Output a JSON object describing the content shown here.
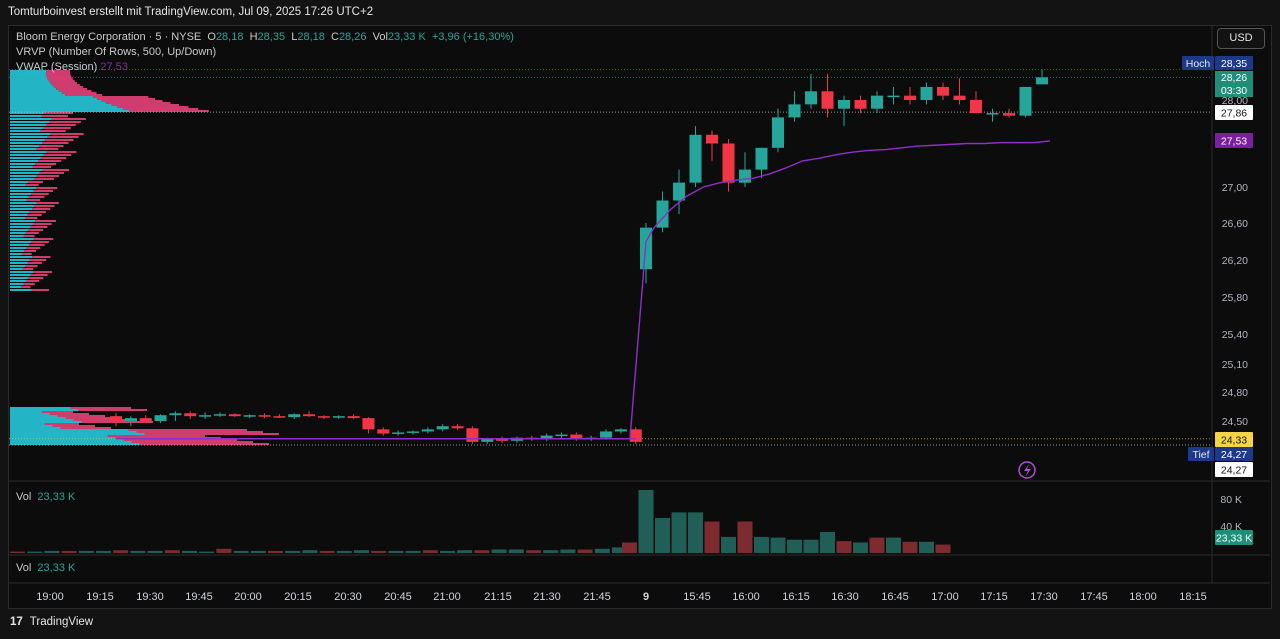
{
  "header": {
    "title": "Tomturboinvest erstellt mit TradingView.com, Jul 09, 2025 17:26 UTC+2"
  },
  "legend": {
    "symbol": "Bloom Energy Corporation · 5 · NYSE",
    "o_label": "O",
    "o": "28,18",
    "h_label": "H",
    "h": "28,35",
    "l_label": "L",
    "l": "28,18",
    "c_label": "C",
    "c": "28,26",
    "vol_label": "Vol",
    "vol": "23,33 K",
    "change": "+3,96 (+16,30%)",
    "vrvp": "VRVP (Number Of Rows, 500, Up/Down)",
    "vwap_label": "VWAP (Session)",
    "vwap": "27,53"
  },
  "currency_button": "USD",
  "vol_pane": {
    "label": "Vol",
    "value": "23,33 K"
  },
  "vol_pane2": {
    "label": "Vol",
    "value": "23,33 K"
  },
  "footer": {
    "brand": "TradingView",
    "logo_glyph": "17"
  },
  "colors": {
    "up": "#26a69a",
    "down": "#f23645",
    "vwap": "#8e2fc9",
    "vol_up": "#1f5f57",
    "vol_down": "#7d2b2f",
    "profile_up": "#26c6da",
    "profile_down": "#f2457f"
  },
  "chart_data": {
    "type": "candlestick",
    "price_axis_ticks": [
      "28,00",
      "27,00",
      "26,60",
      "26,20",
      "25,80",
      "25,40",
      "25,10",
      "24,80",
      "24,50"
    ],
    "price_ylim": [
      23.97,
      28.5
    ],
    "price_tags": [
      {
        "label": "Hoch",
        "value": "28,35"
      },
      {
        "value": "28,26",
        "sub": "03:30"
      },
      {
        "value": "27,86"
      },
      {
        "value": "27,53"
      },
      {
        "value": "24,33"
      },
      {
        "label": "Tief",
        "value": "24,27"
      },
      {
        "value": "24,27"
      }
    ],
    "volume_axis_ticks": [
      "80 K",
      "40 K"
    ],
    "volume_tag": "23,33 K",
    "x_ticks": [
      "19:00",
      "19:15",
      "19:30",
      "19:45",
      "20:00",
      "20:15",
      "20:30",
      "20:45",
      "21:00",
      "21:15",
      "21:30",
      "21:45",
      "9",
      "15:45",
      "16:00",
      "16:15",
      "16:30",
      "16:45",
      "17:00",
      "17:15",
      "17:30",
      "17:45",
      "18:00",
      "18:15"
    ],
    "candles_pre": [
      {
        "o": 24.55,
        "h": 24.58,
        "l": 24.45,
        "c": 24.5
      },
      {
        "o": 24.5,
        "h": 24.55,
        "l": 24.45,
        "c": 24.53
      },
      {
        "o": 24.53,
        "h": 24.56,
        "l": 24.48,
        "c": 24.5
      },
      {
        "o": 24.5,
        "h": 24.57,
        "l": 24.48,
        "c": 24.56
      },
      {
        "o": 24.56,
        "h": 24.6,
        "l": 24.5,
        "c": 24.58
      },
      {
        "o": 24.58,
        "h": 24.6,
        "l": 24.52,
        "c": 24.55
      },
      {
        "o": 24.55,
        "h": 24.59,
        "l": 24.52,
        "c": 24.56
      },
      {
        "o": 24.56,
        "h": 24.59,
        "l": 24.54,
        "c": 24.57
      },
      {
        "o": 24.57,
        "h": 24.58,
        "l": 24.54,
        "c": 24.55
      },
      {
        "o": 24.55,
        "h": 24.57,
        "l": 24.53,
        "c": 24.56
      },
      {
        "o": 24.56,
        "h": 24.58,
        "l": 24.53,
        "c": 24.55
      },
      {
        "o": 24.55,
        "h": 24.57,
        "l": 24.53,
        "c": 24.54
      },
      {
        "o": 24.54,
        "h": 24.58,
        "l": 24.52,
        "c": 24.57
      },
      {
        "o": 24.57,
        "h": 24.6,
        "l": 24.54,
        "c": 24.55
      },
      {
        "o": 24.55,
        "h": 24.56,
        "l": 24.52,
        "c": 24.54
      },
      {
        "o": 24.54,
        "h": 24.56,
        "l": 24.52,
        "c": 24.55
      },
      {
        "o": 24.55,
        "h": 24.57,
        "l": 24.52,
        "c": 24.53
      },
      {
        "o": 24.53,
        "h": 24.54,
        "l": 24.38,
        "c": 24.42
      },
      {
        "o": 24.42,
        "h": 24.44,
        "l": 24.36,
        "c": 24.38
      },
      {
        "o": 24.38,
        "h": 24.41,
        "l": 24.36,
        "c": 24.39
      },
      {
        "o": 24.39,
        "h": 24.41,
        "l": 24.37,
        "c": 24.4
      },
      {
        "o": 24.4,
        "h": 24.44,
        "l": 24.38,
        "c": 24.42
      },
      {
        "o": 24.42,
        "h": 24.47,
        "l": 24.4,
        "c": 24.45
      },
      {
        "o": 24.45,
        "h": 24.47,
        "l": 24.41,
        "c": 24.43
      },
      {
        "o": 24.43,
        "h": 24.45,
        "l": 24.28,
        "c": 24.3
      },
      {
        "o": 24.3,
        "h": 24.34,
        "l": 24.28,
        "c": 24.33
      },
      {
        "o": 24.33,
        "h": 24.35,
        "l": 24.29,
        "c": 24.31
      },
      {
        "o": 24.31,
        "h": 24.35,
        "l": 24.29,
        "c": 24.34
      },
      {
        "o": 24.34,
        "h": 24.36,
        "l": 24.31,
        "c": 24.33
      },
      {
        "o": 24.33,
        "h": 24.38,
        "l": 24.31,
        "c": 24.36
      },
      {
        "o": 24.36,
        "h": 24.39,
        "l": 24.33,
        "c": 24.37
      },
      {
        "o": 24.37,
        "h": 24.39,
        "l": 24.31,
        "c": 24.33
      },
      {
        "o": 24.33,
        "h": 24.36,
        "l": 24.31,
        "c": 24.34
      },
      {
        "o": 24.34,
        "h": 24.42,
        "l": 24.32,
        "c": 24.4
      },
      {
        "o": 24.4,
        "h": 24.43,
        "l": 24.38,
        "c": 24.42
      },
      {
        "o": 24.42,
        "h": 24.44,
        "l": 24.28,
        "c": 24.3
      }
    ],
    "candles_session": [
      {
        "o": 26.1,
        "h": 26.6,
        "l": 25.95,
        "c": 26.55
      },
      {
        "o": 26.55,
        "h": 26.95,
        "l": 26.5,
        "c": 26.85
      },
      {
        "o": 26.85,
        "h": 27.2,
        "l": 26.7,
        "c": 27.05
      },
      {
        "o": 27.05,
        "h": 27.7,
        "l": 27.0,
        "c": 27.6
      },
      {
        "o": 27.6,
        "h": 27.65,
        "l": 27.3,
        "c": 27.5
      },
      {
        "o": 27.5,
        "h": 27.55,
        "l": 26.95,
        "c": 27.05
      },
      {
        "o": 27.05,
        "h": 27.4,
        "l": 27.0,
        "c": 27.2
      },
      {
        "o": 27.2,
        "h": 27.45,
        "l": 27.1,
        "c": 27.45
      },
      {
        "o": 27.45,
        "h": 27.9,
        "l": 27.4,
        "c": 27.8
      },
      {
        "o": 27.8,
        "h": 28.1,
        "l": 27.75,
        "c": 27.95
      },
      {
        "o": 27.95,
        "h": 28.3,
        "l": 27.9,
        "c": 28.1
      },
      {
        "o": 28.1,
        "h": 28.3,
        "l": 27.8,
        "c": 27.9
      },
      {
        "o": 27.9,
        "h": 28.05,
        "l": 27.7,
        "c": 28.0
      },
      {
        "o": 28.0,
        "h": 28.05,
        "l": 27.85,
        "c": 27.9
      },
      {
        "o": 27.9,
        "h": 28.1,
        "l": 27.85,
        "c": 28.05
      },
      {
        "o": 28.05,
        "h": 28.15,
        "l": 27.95,
        "c": 28.05
      },
      {
        "o": 28.05,
        "h": 28.15,
        "l": 27.95,
        "c": 28.0
      },
      {
        "o": 28.0,
        "h": 28.2,
        "l": 27.95,
        "c": 28.15
      },
      {
        "o": 28.15,
        "h": 28.2,
        "l": 28.0,
        "c": 28.05
      },
      {
        "o": 28.05,
        "h": 28.25,
        "l": 27.95,
        "c": 28.0
      },
      {
        "o": 28.0,
        "h": 28.1,
        "l": 27.85,
        "c": 27.85
      },
      {
        "o": 27.85,
        "h": 27.9,
        "l": 27.75,
        "c": 27.85
      },
      {
        "o": 27.85,
        "h": 27.9,
        "l": 27.8,
        "c": 27.82
      },
      {
        "o": 27.82,
        "h": 28.15,
        "l": 27.8,
        "c": 28.15
      },
      {
        "o": 28.18,
        "h": 28.35,
        "l": 28.18,
        "c": 28.26
      }
    ],
    "vwap_session": [
      26.55,
      26.75,
      26.9,
      27.0,
      27.05,
      27.08,
      27.1,
      27.15,
      27.22,
      27.3,
      27.33,
      27.37,
      27.4,
      27.42,
      27.43,
      27.45,
      27.47,
      27.48,
      27.49,
      27.5,
      27.5,
      27.51,
      27.51,
      27.51,
      27.53
    ],
    "volume_pre": [
      2,
      2,
      3,
      3,
      3,
      3,
      4,
      3,
      3,
      4,
      3,
      2,
      6,
      3,
      3,
      3,
      3,
      4,
      3,
      3,
      4,
      3,
      3,
      3,
      4,
      3,
      4,
      4,
      5,
      5,
      4,
      4,
      5,
      5,
      6,
      8
    ],
    "volume_session": [
      15,
      90,
      50,
      58,
      58,
      45,
      23,
      45,
      23,
      22,
      19,
      19,
      30,
      17,
      15,
      22,
      22,
      16,
      16,
      12
    ],
    "volume_session_up": [
      false,
      true,
      true,
      true,
      true,
      false,
      true,
      false,
      true,
      true,
      true,
      true,
      true,
      false,
      true,
      false,
      true,
      false,
      true,
      false
    ]
  }
}
